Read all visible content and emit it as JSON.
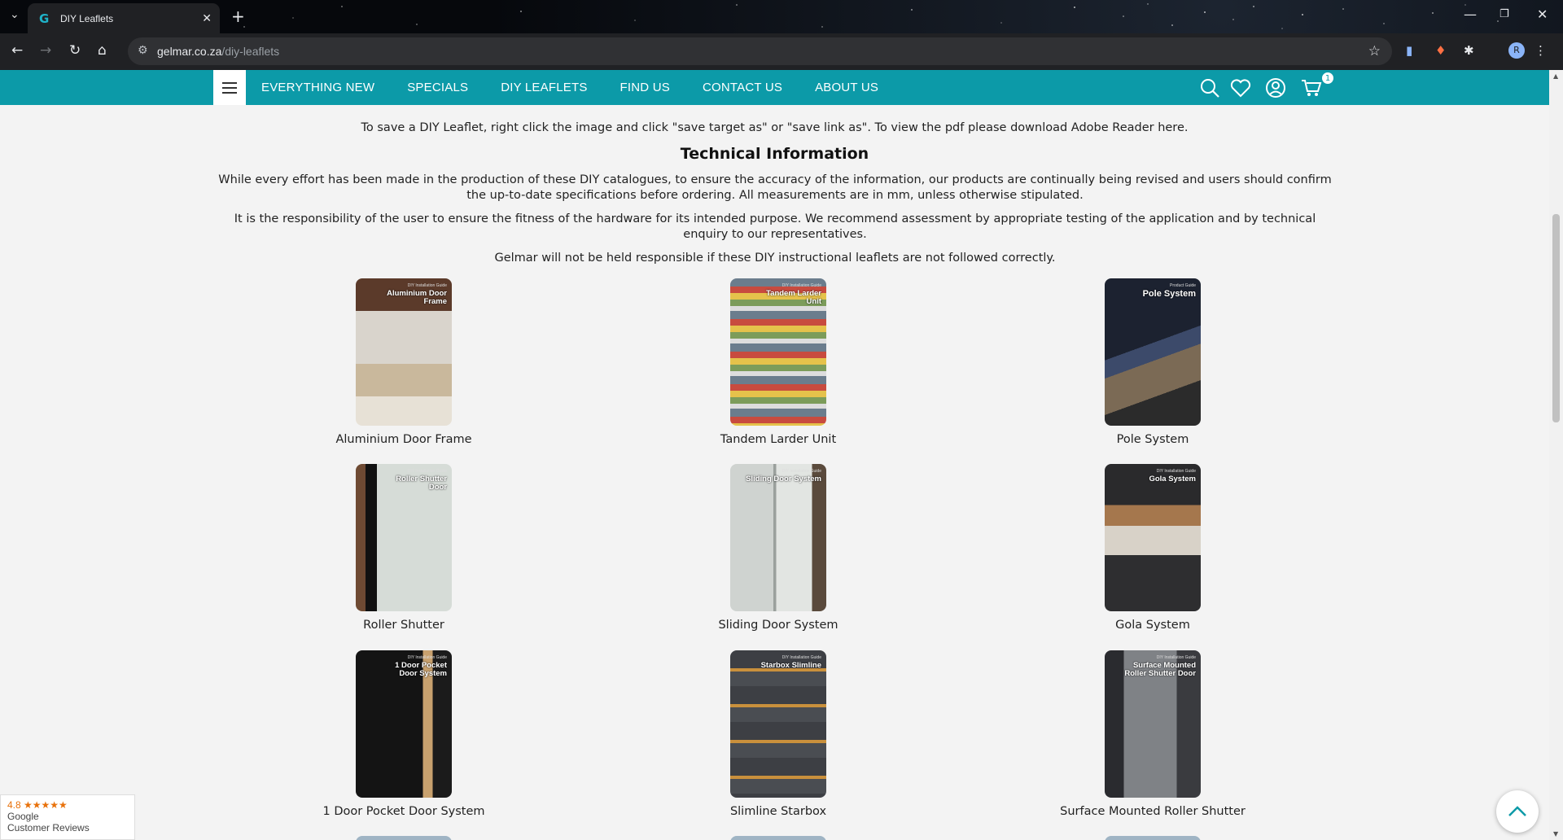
{
  "browser": {
    "tab_title": "DIY Leaflets",
    "url_host": "gelmar.co.za",
    "url_path": "/diy-leaflets",
    "profile_initial": "R"
  },
  "site_nav": {
    "links": [
      "EVERYTHING NEW",
      "SPECIALS",
      "DIY LEAFLETS",
      "FIND US",
      "CONTACT US",
      "ABOUT US"
    ],
    "cart_count": "1"
  },
  "content": {
    "save_note": "To save a DIY Leaflet, right click the image and click \"save target as\" or \"save link as\". To view the pdf please download Adobe Reader here.",
    "heading": "Technical Information",
    "para1": "While every effort has been made in the production of these DIY catalogues, to ensure the accuracy of the information, our products are continually being revised and users should confirm the up-to-date specifications before ordering. All measurements are in mm, unless otherwise stipulated.",
    "para2": "It is the responsibility of the user to ensure the fitness of the hardware for its intended purpose. We recommend assessment by appropriate testing of the application and by technical enquiry to our representatives.",
    "para3": "Gelmar will not be held responsible if these DIY instructional leaflets are not followed correctly."
  },
  "leaflets": [
    {
      "name": "Aluminium Door Frame",
      "cover_title": "Aluminium Door Frame",
      "kicker": "DIY Installation Guide"
    },
    {
      "name": "Tandem Larder Unit",
      "cover_title": "Tandem Larder Unit",
      "kicker": "DIY Installation Guide"
    },
    {
      "name": "Pole System",
      "cover_title": "Pole System",
      "kicker": "Product Guide"
    },
    {
      "name": "Roller Shutter",
      "cover_title": "Roller Shutter Door",
      "kicker": "DIY Installation Guide"
    },
    {
      "name": "Sliding Door System",
      "cover_title": "Sliding Door System",
      "kicker": "DIY Installation Guide"
    },
    {
      "name": "Gola System",
      "cover_title": "Gola System",
      "kicker": "DIY Installation Guide"
    },
    {
      "name": "1 Door Pocket Door System",
      "cover_title": "1 Door Pocket Door System",
      "kicker": "DIY Installation Guide"
    },
    {
      "name": "Slimline Starbox",
      "cover_title": "Starbox Slimline",
      "kicker": "DIY Installation Guide"
    },
    {
      "name": "Surface Mounted Roller Shutter",
      "cover_title": "Surface Mounted Roller Shutter Door",
      "kicker": "DIY Installation Guide"
    }
  ],
  "google_badge": {
    "rating": "4.8 ★★★★★",
    "line1": "Google",
    "line2": "Customer Reviews"
  },
  "colors": {
    "brand_teal": "#0c9aa8",
    "page_bg": "#f3f3f3"
  }
}
